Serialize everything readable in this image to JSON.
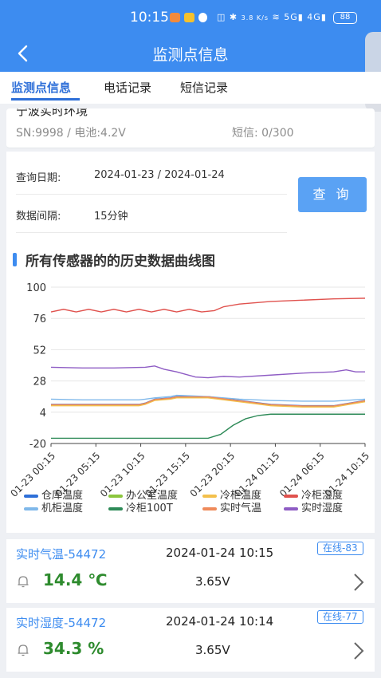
{
  "status_bar": {
    "time": "10:15",
    "network_speed": "3.8 K/s",
    "signal_1": "5G",
    "signal_2": "4G",
    "battery": "88"
  },
  "header": {
    "title": "监测点信息"
  },
  "tabs": [
    {
      "label": "监测点信息",
      "active": true
    },
    {
      "label": "电话记录"
    },
    {
      "label": "短信记录"
    }
  ],
  "device": {
    "name_cut": "宁波实时环境",
    "sn_battery": "SN:9998 / 电池:4.2V",
    "sms": "短信: 0/300"
  },
  "query": {
    "date_label": "查询日期:",
    "date_value": "2024-01-23 / 2024-01-24",
    "interval_label": "数据间隔:",
    "interval_value": "15分钟",
    "button": "查 询"
  },
  "chart_section": {
    "title": "所有传感器的的历史数据曲线图"
  },
  "chart_data": {
    "type": "line",
    "y_ticks": [
      "100",
      "76",
      "52",
      "28",
      "4",
      "-20"
    ],
    "ylim": [
      -20,
      100
    ],
    "grid": true,
    "x_tick_labels": [
      "01-23 00:15",
      "01-23 05:15",
      "01-23 10:15",
      "01-23 15:15",
      "01-23 20:15",
      "01-24 01:15",
      "01-24 06:15",
      "01-24 10:15"
    ],
    "legend_position": "bottom",
    "series": [
      {
        "name": "仓库温度",
        "color": "#2e6fd8",
        "x": [
          0,
          10,
          20,
          28,
          30,
          33,
          38,
          40,
          45,
          50,
          60,
          70,
          80,
          90,
          100
        ],
        "y": [
          10,
          10,
          10,
          10,
          11,
          14,
          15,
          16,
          16,
          16,
          13,
          10,
          9,
          9,
          13
        ]
      },
      {
        "name": "办公室温度",
        "color": "#8cc63e",
        "x": [
          0,
          10,
          20,
          28,
          30,
          33,
          38,
          40,
          45,
          50,
          60,
          70,
          80,
          90,
          100
        ],
        "y": [
          9.5,
          9.5,
          9.5,
          9.5,
          10.5,
          13.5,
          14.5,
          15.5,
          15.5,
          15.5,
          12.5,
          9.5,
          8.5,
          8.5,
          12.5
        ]
      },
      {
        "name": "冷柜温度",
        "color": "#f3c04c",
        "x": [
          0,
          10,
          20,
          28,
          30,
          33,
          38,
          40,
          45,
          50,
          60,
          70,
          80,
          90,
          100
        ],
        "y": [
          9,
          9,
          9,
          9,
          10,
          13,
          14,
          15,
          15,
          15,
          12,
          9,
          8,
          8,
          12
        ]
      },
      {
        "name": "冷柜湿度",
        "color": "#e0524e",
        "x": [
          0,
          4,
          8,
          12,
          16,
          20,
          24,
          28,
          32,
          36,
          40,
          44,
          48,
          52,
          55,
          60,
          70,
          80,
          90,
          100
        ],
        "y": [
          81,
          83,
          81,
          83,
          81,
          83,
          81,
          83,
          81,
          83,
          81,
          83,
          81,
          82,
          85,
          87,
          89,
          90,
          91,
          91.5
        ]
      },
      {
        "name": "机柜温度",
        "color": "#7fb8ea",
        "x": [
          0,
          10,
          20,
          28,
          30,
          33,
          38,
          40,
          45,
          50,
          60,
          70,
          80,
          90,
          100
        ],
        "y": [
          14,
          13.5,
          13.5,
          13.5,
          14,
          15,
          16,
          17,
          16.5,
          16,
          14,
          13,
          12.5,
          12.5,
          14
        ]
      },
      {
        "name": "冷柜100T",
        "color": "#2d8a57",
        "x": [
          0,
          10,
          20,
          30,
          40,
          50,
          54,
          58,
          62,
          66,
          70,
          80,
          90,
          100
        ],
        "y": [
          -16,
          -16,
          -16,
          -16,
          -16,
          -16,
          -13,
          -6,
          -1,
          1.5,
          2.5,
          2.5,
          2.5,
          2.5
        ]
      },
      {
        "name": "实时气温",
        "color": "#ef8a5a",
        "x": [
          0,
          10,
          20,
          28,
          30,
          33,
          38,
          40,
          45,
          50,
          60,
          70,
          80,
          90,
          100
        ],
        "y": [
          9.8,
          9.8,
          9.8,
          9.8,
          10.8,
          13.8,
          14.8,
          15.8,
          15.8,
          15.8,
          12.8,
          9.8,
          8.8,
          8.8,
          12.8
        ]
      },
      {
        "name": "实时湿度",
        "color": "#8e5cc4",
        "x": [
          0,
          10,
          20,
          30,
          33,
          36,
          40,
          46,
          50,
          55,
          60,
          70,
          80,
          90,
          94,
          97,
          100
        ],
        "y": [
          38.5,
          38,
          38,
          38.5,
          39.5,
          37,
          35,
          31,
          30.5,
          31.5,
          31,
          32.5,
          34,
          35,
          36.5,
          35,
          35
        ]
      }
    ]
  },
  "readings": [
    {
      "name": "实时气温-54472",
      "time": "2024-01-24 10:15",
      "badge": "在线-83",
      "value": "14.4 ℃",
      "voltage": "3.65V"
    },
    {
      "name": "实时湿度-54472",
      "time": "2024-01-24 10:14",
      "badge": "在线-77",
      "value": "34.3 %",
      "voltage": "3.65V"
    }
  ],
  "colors": {
    "primary": "#3d8cf0",
    "value_green": "#2e8b2e",
    "button": "#5aa2f4"
  }
}
